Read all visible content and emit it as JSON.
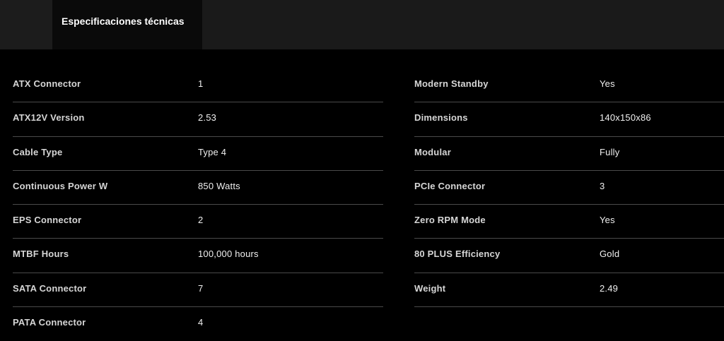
{
  "tabs": {
    "active_label": "Especificaciones técnicas"
  },
  "specs_left": [
    {
      "label": "ATX Connector",
      "value": "1"
    },
    {
      "label": "ATX12V Version",
      "value": "2.53"
    },
    {
      "label": "Cable Type",
      "value": "Type 4"
    },
    {
      "label": "Continuous Power W",
      "value": "850 Watts"
    },
    {
      "label": "EPS Connector",
      "value": "2"
    },
    {
      "label": "MTBF Hours",
      "value": "100,000 hours"
    },
    {
      "label": "SATA Connector",
      "value": "7"
    },
    {
      "label": "PATA Connector",
      "value": "4"
    }
  ],
  "specs_right": [
    {
      "label": "Modern Standby",
      "value": "Yes"
    },
    {
      "label": "Dimensions",
      "value": "140x150x86"
    },
    {
      "label": "Modular",
      "value": "Fully"
    },
    {
      "label": "PCIe Connector",
      "value": "3"
    },
    {
      "label": "Zero RPM Mode",
      "value": "Yes"
    },
    {
      "label": "80 PLUS Efficiency",
      "value": "Gold"
    },
    {
      "label": "Weight",
      "value": "2.49"
    }
  ]
}
